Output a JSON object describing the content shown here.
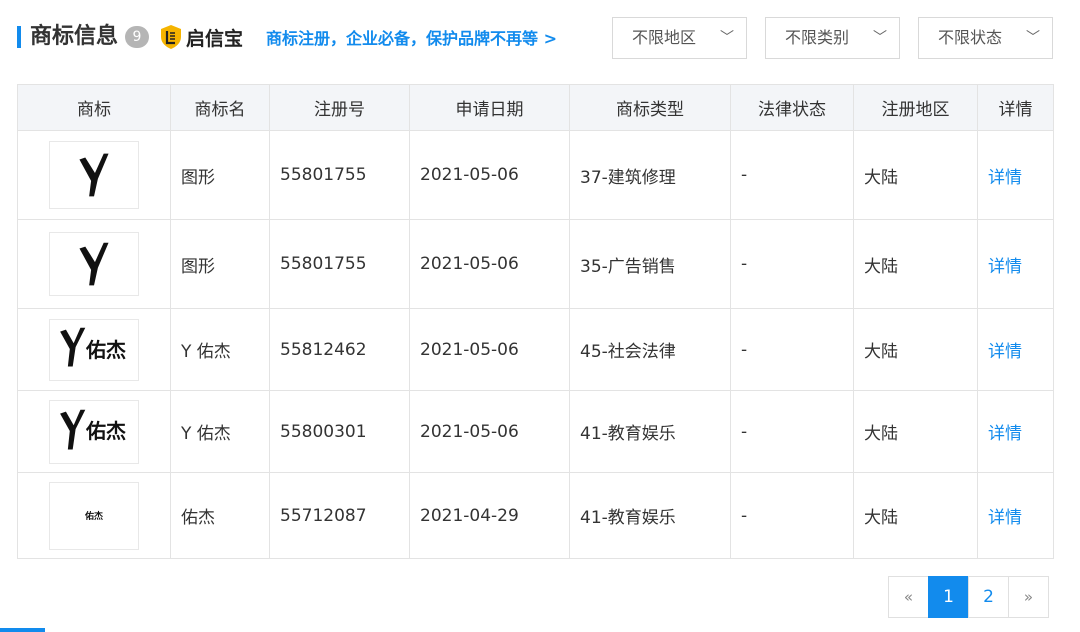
{
  "section": {
    "title": "商标信息",
    "count": "9",
    "brand_name": "启信宝",
    "promo_link": "商标注册，企业必备，保护品牌不再等 >"
  },
  "filters": [
    {
      "label": "不限地区"
    },
    {
      "label": "不限类别"
    },
    {
      "label": "不限状态"
    }
  ],
  "table": {
    "headers": [
      "商标",
      "商标名",
      "注册号",
      "申请日期",
      "商标类型",
      "法律状态",
      "注册地区",
      "详情"
    ],
    "rows": [
      {
        "name": "图形",
        "reg_no": "55801755",
        "date": "2021-05-06",
        "type": "37-建筑修理",
        "status": "-",
        "region": "大陆",
        "detail": "详情",
        "logo_text": ""
      },
      {
        "name": "图形",
        "reg_no": "55801755",
        "date": "2021-05-06",
        "type": "35-广告销售",
        "status": "-",
        "region": "大陆",
        "detail": "详情",
        "logo_text": ""
      },
      {
        "name": "Y 佑杰",
        "reg_no": "55812462",
        "date": "2021-05-06",
        "type": "45-社会法律",
        "status": "-",
        "region": "大陆",
        "detail": "详情",
        "logo_text": "佑杰"
      },
      {
        "name": "Y 佑杰",
        "reg_no": "55800301",
        "date": "2021-05-06",
        "type": "41-教育娱乐",
        "status": "-",
        "region": "大陆",
        "detail": "详情",
        "logo_text": "佑杰"
      },
      {
        "name": "佑杰",
        "reg_no": "55712087",
        "date": "2021-04-29",
        "type": "41-教育娱乐",
        "status": "-",
        "region": "大陆",
        "detail": "详情",
        "logo_text": "佑杰"
      }
    ]
  },
  "pagination": {
    "prev": "«",
    "pages": [
      "1",
      "2"
    ],
    "next": "»",
    "current": "1"
  },
  "colors": {
    "accent": "#128bed",
    "badge": "#b5b5b5",
    "brand_gold": "#f5b400"
  },
  "icons": {
    "dropdown": "chevron-down-icon",
    "brand": "shield-logo-icon"
  }
}
